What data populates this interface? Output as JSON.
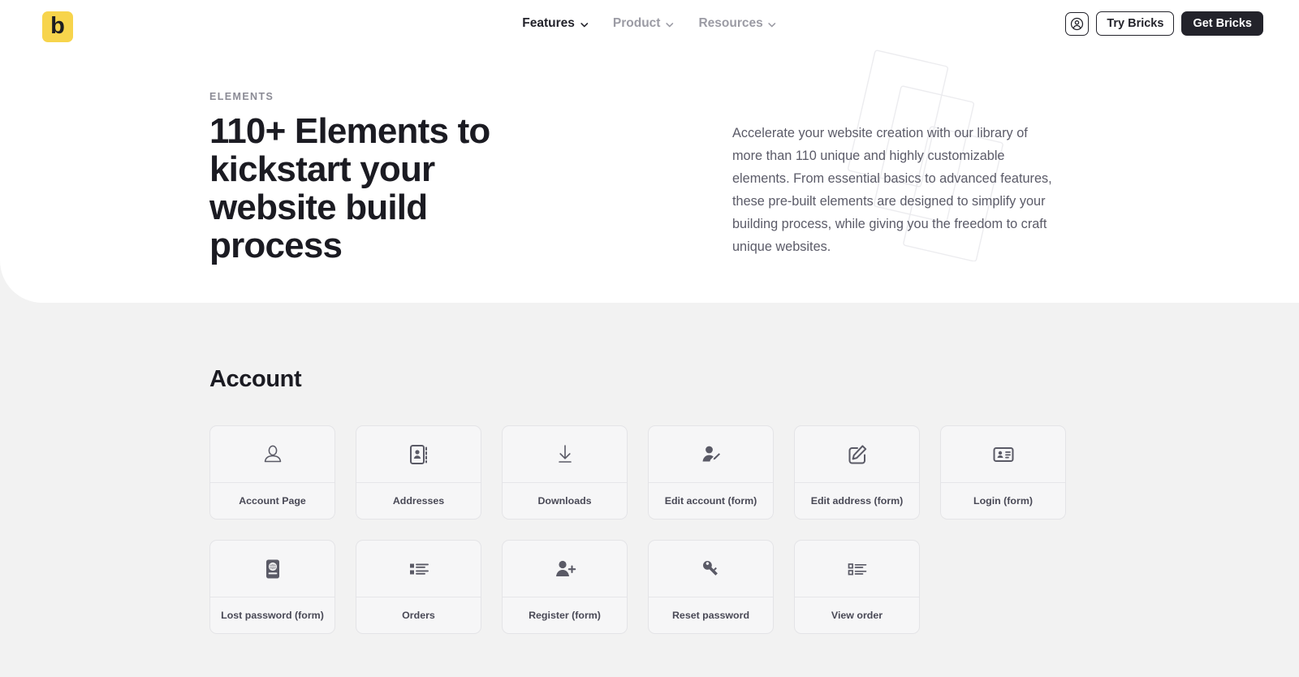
{
  "nav": {
    "logo_letter": "b",
    "logo_color": "#f7d44c",
    "links": [
      {
        "label": "Features",
        "icon": "chevron-down-icon",
        "active": true
      },
      {
        "label": "Product",
        "icon": "chevron-down-icon",
        "active": false
      },
      {
        "label": "Resources",
        "icon": "chevron-down-icon",
        "active": false
      }
    ],
    "account_icon": "user-circle-icon",
    "try_label": "Try Bricks",
    "get_label": "Get Bricks",
    "get_bg": "#23232b"
  },
  "hero": {
    "eyebrow": "ELEMENTS",
    "title": "110+ Elements to kickstart your website build process",
    "description": "Accelerate your website creation with our library of more than 110 unique and highly customizable elements. From essential basics to advanced features, these pre-built elements are designed to simplify your building process, while giving you the freedom to craft unique websites."
  },
  "section": {
    "title": "Account",
    "cards": [
      {
        "label": "Account Page",
        "icon": "user-outline-icon"
      },
      {
        "label": "Addresses",
        "icon": "address-book-icon"
      },
      {
        "label": "Downloads",
        "icon": "download-icon"
      },
      {
        "label": "Edit account (form)",
        "icon": "user-edit-icon"
      },
      {
        "label": "Edit address (form)",
        "icon": "square-pencil-icon"
      },
      {
        "label": "Login (form)",
        "icon": "id-card-icon"
      },
      {
        "label": "Lost password (form)",
        "icon": "passport-globe-icon"
      },
      {
        "label": "Orders",
        "icon": "list-filled-icon"
      },
      {
        "label": "Register (form)",
        "icon": "user-plus-icon"
      },
      {
        "label": "Reset password",
        "icon": "key-icon"
      },
      {
        "label": "View order",
        "icon": "list-outline-icon"
      }
    ]
  }
}
